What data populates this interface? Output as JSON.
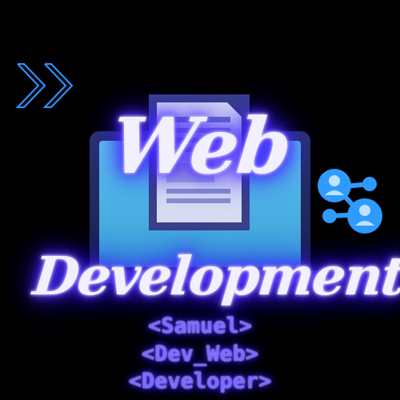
{
  "title": {
    "line1": "Web",
    "line2": "Development"
  },
  "tags": {
    "line1": "<Samuel>",
    "line2": "<Dev_Web>",
    "line3": "<Developer>"
  },
  "colors": {
    "background": "#000000",
    "title_glow": "#4a2bff",
    "code_text": "#7c6cff",
    "screen": "#4fb8e8",
    "accent_blue": "#1e90ff"
  },
  "icons": [
    "double-chevron-right-icon",
    "laptop-icon",
    "document-icon",
    "user-network-icon"
  ]
}
